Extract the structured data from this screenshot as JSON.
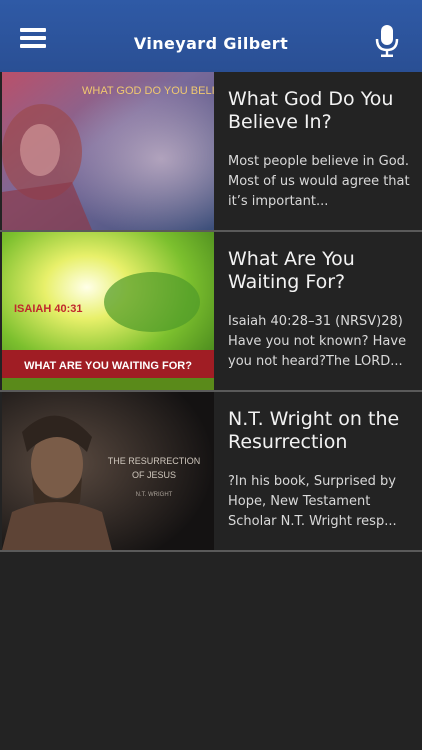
{
  "header": {
    "title": "Vineyard Gilbert",
    "menu_icon": "hamburger-menu-icon",
    "mic_icon": "microphone-icon",
    "color": "#2f5aa6"
  },
  "items": [
    {
      "title": "What God Do You Believe In?",
      "description": "Most people believe in God. Most of us would agree that it’s important...",
      "image_text": "WHAT GOD DO YOU BELIEVE IN?"
    },
    {
      "title": "What Are You Waiting For?",
      "description": "Isaiah 40:28–31 (NRSV)28) Have you not known? Have you not heard?The LORD...",
      "image_text": "ISAIAH 40:31",
      "image_banner": "WHAT ARE YOU WAITING FOR?"
    },
    {
      "title": "N.T. Wright on the Resurrection",
      "description": "?In his book, Surprised by Hope, New Testament Scholar N.T. Wright resp...",
      "image_text": "THE RESURRECTION",
      "image_text_2": "OF JESUS",
      "image_author": "N.T. WRIGHT"
    }
  ]
}
